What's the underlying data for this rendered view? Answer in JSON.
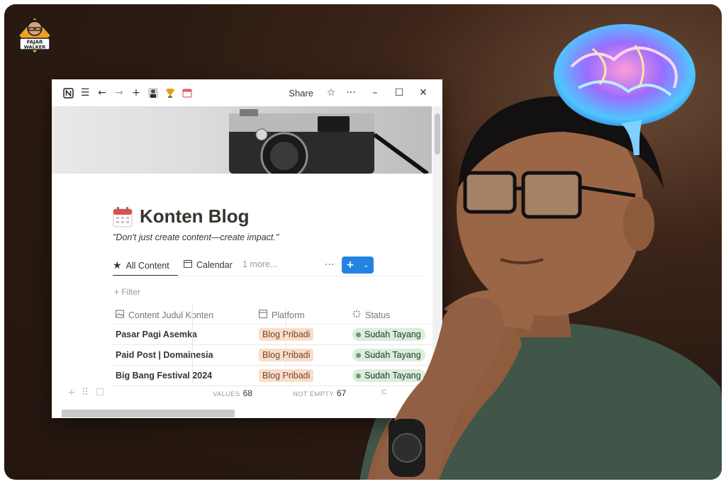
{
  "logo": {
    "line1": "FAJAR",
    "line2": "WALKER"
  },
  "window": {
    "share_label": "Share",
    "page_title": "Konten Blog",
    "quote": "\"Don't just create content—create impact.\"",
    "tabs": [
      {
        "label": "All Content",
        "icon": "star-icon",
        "active": true
      },
      {
        "label": "Calendar",
        "icon": "calendar-view-icon",
        "active": false
      },
      {
        "label": "1 more...",
        "icon": "",
        "active": false
      }
    ],
    "filter_label": "+ Filter",
    "columns": [
      {
        "label": "Content Judul Konten",
        "icon": "image-icon"
      },
      {
        "label": "Platform",
        "icon": "select-icon"
      },
      {
        "label": "Status",
        "icon": "status-icon"
      }
    ],
    "rows": [
      {
        "title": "Pasar Pagi Asemka",
        "platform": "Blog Pribadi",
        "status": "Sudah Tayang"
      },
      {
        "title": "Paid Post | Domainesia",
        "platform": "Blog Pribadi",
        "status": "Sudah Tayang"
      },
      {
        "title": "Big Bang Festival 2024",
        "platform": "Blog Pribadi",
        "status": "Sudah Tayang"
      }
    ],
    "footer": {
      "values_label": "VALUES",
      "values_count": "68",
      "not_empty_label": "NOT EMPTY",
      "not_empty_count": "67",
      "trailing": "C"
    }
  },
  "colors": {
    "background": "#2a1a12",
    "accent_blue": "#2383e2",
    "tag_orange": "#fadec9",
    "status_green": "#dbeddb"
  }
}
